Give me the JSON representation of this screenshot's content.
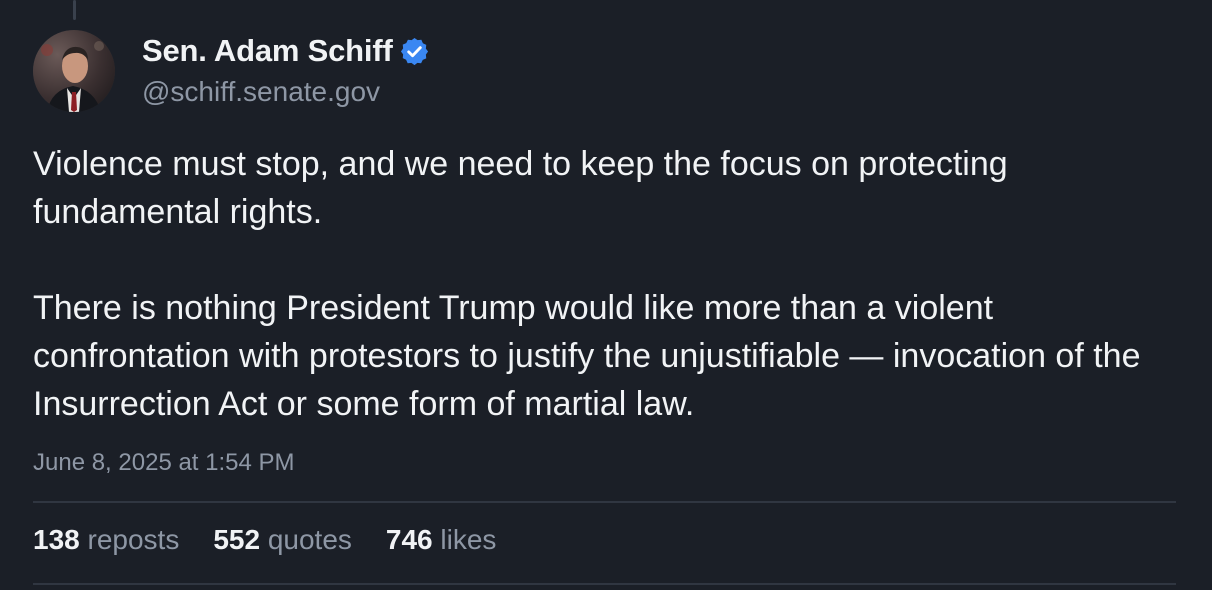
{
  "author": {
    "display_name": "Sen. Adam Schiff",
    "handle": "@schiff.senate.gov",
    "verified_icon": "verified-check-icon",
    "verified_color": "#3a87f2"
  },
  "post": {
    "paragraphs": [
      "Violence must stop, and we need to keep the focus on protecting fundamental rights.",
      "There is nothing President Trump would like more than a violent confrontation with protestors to justify the unjustifiable — invocation of the Insurrection Act or some form of martial law."
    ],
    "timestamp": "June 8, 2025 at 1:54 PM"
  },
  "stats": [
    {
      "count": "138",
      "label": "reposts"
    },
    {
      "count": "552",
      "label": "quotes"
    },
    {
      "count": "746",
      "label": "likes"
    }
  ],
  "colors": {
    "background": "#1b1f27",
    "text": "#f1f3f5",
    "muted": "#8e97a5",
    "divider": "#303641"
  }
}
